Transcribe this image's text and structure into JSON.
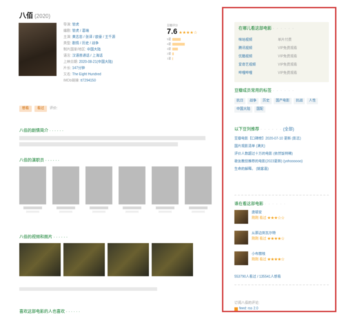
{
  "movie": {
    "title": "八佰",
    "year": "(2020)"
  },
  "info_rows": [
    {
      "k": "导演:",
      "v": "管虎"
    },
    {
      "k": "编剧:",
      "v": "管虎 / 葛瑞"
    },
    {
      "k": "主演:",
      "v": "黄志忠 / 张译 / 欧豪 / 王千源"
    },
    {
      "k": "类型:",
      "v": "剧情 / 历史 / 战争"
    },
    {
      "k": "制片国家/地区:",
      "v": "中国大陆"
    },
    {
      "k": "语言:",
      "v": "汉语普通话 / 上海话"
    },
    {
      "k": "上映日期:",
      "v": "2020-08-21(中国大陆)"
    },
    {
      "k": "片长:",
      "v": "147分钟"
    },
    {
      "k": "又名:",
      "v": "The Eight Hundred"
    },
    {
      "k": "IMDb链接:",
      "v": "tt7294150"
    }
  ],
  "rating": {
    "label": "豆瓣评分",
    "value": "7.6",
    "stars": "★★★★☆",
    "bars": [
      {
        "label": "5星",
        "pct": 0.3
      },
      {
        "label": "4星",
        "pct": 0.45
      },
      {
        "label": "3星",
        "pct": 0.2
      },
      {
        "label": "2星",
        "pct": 0.04
      },
      {
        "label": "1星",
        "pct": 0.01
      }
    ]
  },
  "actions": {
    "want": "想看",
    "seen": "看过",
    "rate": "评价:"
  },
  "sections": {
    "plot": "八佰的剧情简介 · · · · · ·",
    "cast": "八佰的演职员 · · · · · ·",
    "stills": "八佰的视频和图片 · · · · · ·",
    "recs": "喜欢这部电影的人也喜欢 · · · · · ·"
  },
  "sidebar": {
    "where_title": "在哪儿看这部电影",
    "dots": "· · · · · ·",
    "sources": [
      {
        "name": "咪咕视频",
        "price": "单片付费"
      },
      {
        "name": "腾讯视频",
        "price": "VIP免费观看"
      },
      {
        "name": "优酷视频",
        "price": "VIP免费观看"
      },
      {
        "name": "爱奇艺视频",
        "price": "VIP免费观看"
      },
      {
        "name": "哔哩哔哩",
        "price": "VIP免费观看"
      }
    ],
    "tags_title": "豆瓣成员常用的标签",
    "tags": [
      "抗日",
      "战争",
      "历史",
      "国产电影",
      "抗战",
      "人性",
      "中国大陆",
      "国配"
    ],
    "list_title": "以下豆列推荐",
    "list_all": "(全部)",
    "lists": [
      {
        "text": "豆瓣电影【口碑榜】2020-07-10 更新 (影志)"
      },
      {
        "text": "国片观影清单 (满天)"
      },
      {
        "text": "评价人数超过十万的电影 (依然饭特稀)"
      },
      {
        "text": "歌友教授推荐的电影(2023更新) (yohoooooo)"
      },
      {
        "text": "生命的解释。 (姚客嘉)"
      }
    ],
    "watching_title": "谁在看这部电影",
    "watchers": [
      {
        "name": "唐顿安",
        "action": "刚刚 看过",
        "stars": "★★★☆☆"
      },
      {
        "name": "从那边到瓦尔特",
        "action": "刚刚 看过",
        "stars": "★★★★☆"
      },
      {
        "name": "小布丽枝",
        "action": "刚刚 看过",
        "stars": "★★★★☆"
      }
    ],
    "counts": "553790人看过  /  135541人想看",
    "rss_label": "订阅八佰的评论:",
    "rss_link": "feed: rss 2.0"
  }
}
